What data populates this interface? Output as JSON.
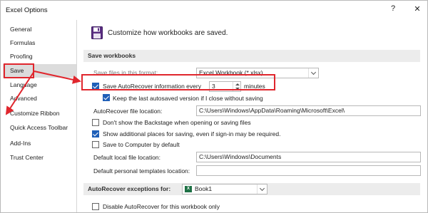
{
  "window": {
    "title": "Excel Options",
    "help": "?",
    "close": "✕"
  },
  "sidebar": {
    "items": [
      {
        "label": "General"
      },
      {
        "label": "Formulas"
      },
      {
        "label": "Proofing"
      },
      {
        "label": "Save",
        "active": true
      },
      {
        "label": "Language"
      },
      {
        "label": "Advanced"
      },
      {
        "label": "Customize Ribbon"
      },
      {
        "label": "Quick Access Toolbar"
      },
      {
        "label": "Add-Ins"
      },
      {
        "label": "Trust Center"
      }
    ]
  },
  "header": {
    "icon": "floppy-disk-icon",
    "text": "Customize how workbooks are saved."
  },
  "save_section": {
    "title": "Save workbooks",
    "format_label": "Save files in this format:",
    "format_value": "Excel Workbook (*.xlsx)",
    "autorecover_label": "Save AutoRecover information every",
    "autorecover_minutes": "3",
    "minutes_label": "minutes",
    "autorecover_checked": true,
    "keep_last_label": "Keep the last autosaved version if I close without saving",
    "keep_last_checked": true,
    "ar_location_label": "AutoRecover file location:",
    "ar_location_value": "C:\\Users\\Windows\\AppData\\Roaming\\Microsoft\\Excel\\",
    "backstage_label": "Don't show the Backstage when opening or saving files",
    "backstage_checked": false,
    "additional_places_label": "Show additional places for saving, even if sign-in may be required.",
    "additional_places_checked": true,
    "save_computer_label": "Save to Computer by default",
    "save_computer_checked": false,
    "default_local_label": "Default local file location:",
    "default_local_value": "C:\\Users\\Windows\\Documents",
    "personal_templates_label": "Default personal templates location:",
    "personal_templates_value": ""
  },
  "exceptions_section": {
    "title": "AutoRecover exceptions for:",
    "workbook": "Book1",
    "workbook_icon": "excel-icon",
    "disable_label": "Disable AutoRecover for this workbook only",
    "disable_checked": false
  },
  "annotation": {
    "color": "#e0262d"
  }
}
